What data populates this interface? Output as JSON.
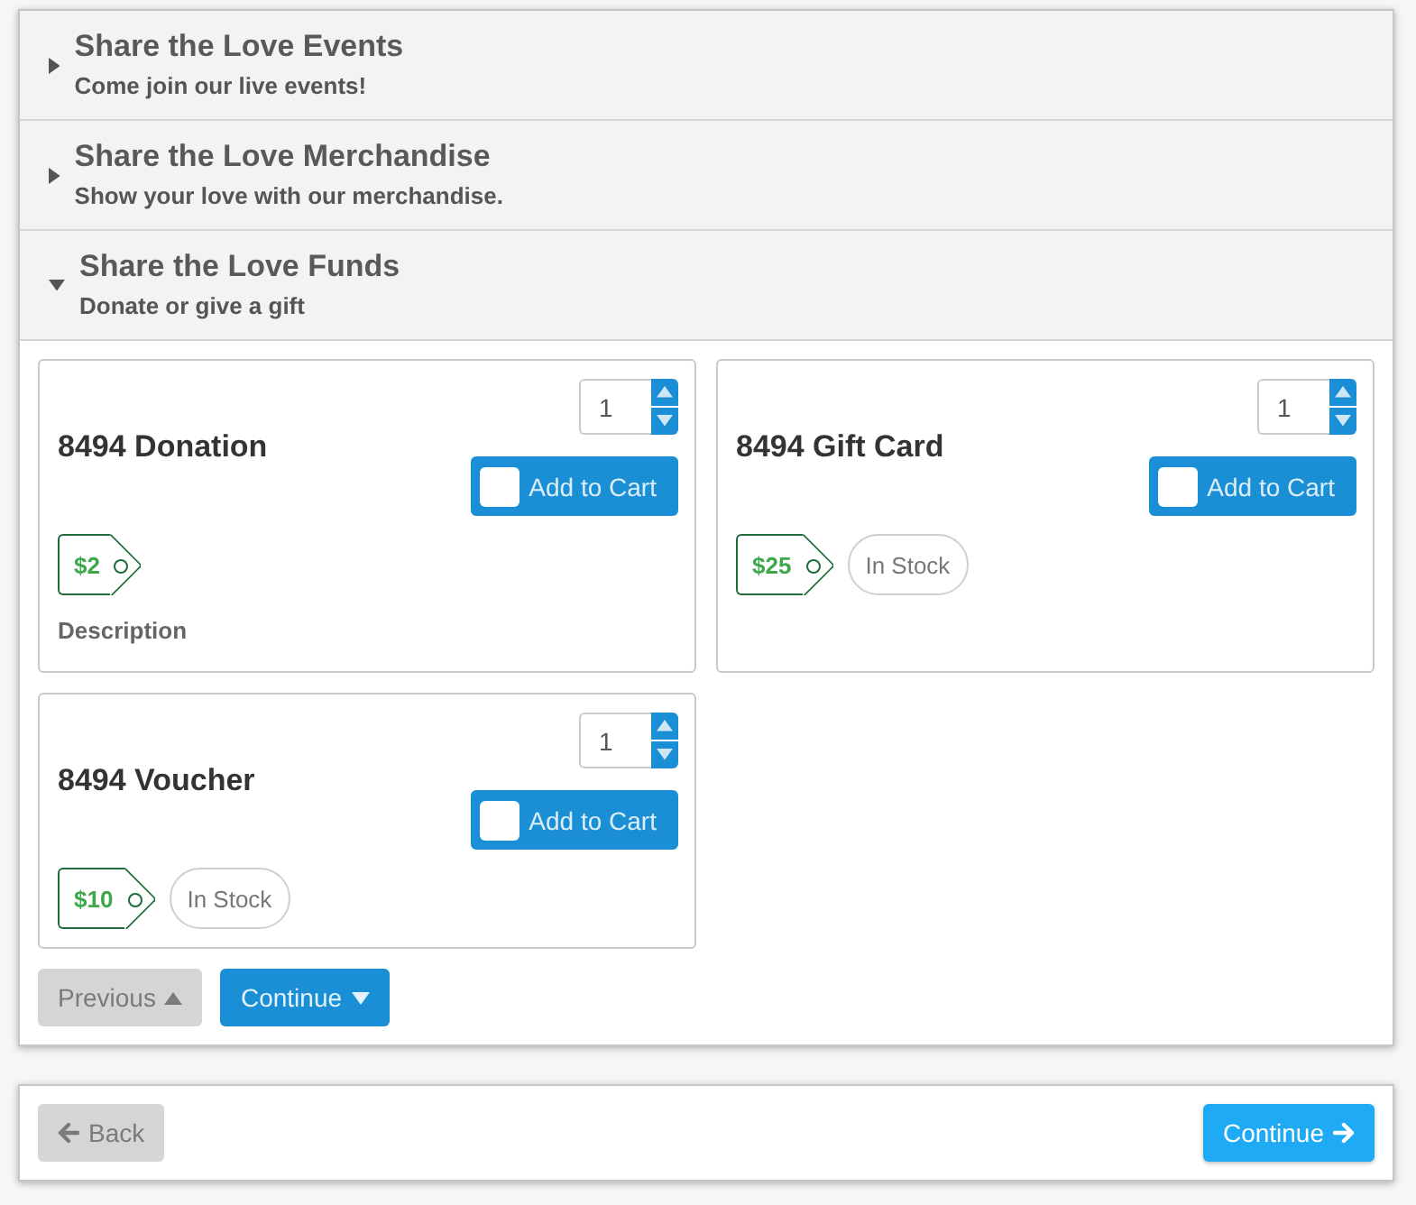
{
  "sections": [
    {
      "title": "Share the Love Events",
      "subtitle": "Come join our live events!",
      "expanded": false
    },
    {
      "title": "Share the Love Merchandise",
      "subtitle": "Show your love with our merchandise.",
      "expanded": false
    },
    {
      "title": "Share the Love Funds",
      "subtitle": "Donate or give a gift",
      "expanded": true,
      "products": [
        {
          "name": "8494 Donation",
          "quantity": "1",
          "checked": false,
          "button": "Add to Cart",
          "price": "$2",
          "description": "Description"
        },
        {
          "name": "8494 Gift Card",
          "quantity": "1",
          "checked": false,
          "button": "Add to Cart",
          "price": "$25",
          "stock": "In Stock"
        },
        {
          "name": "8494 Voucher",
          "quantity": "1",
          "checked": false,
          "button": "Add to Cart",
          "price": "$10",
          "stock": "In Stock"
        }
      ],
      "buttons": [
        {
          "label": "Previous",
          "kind": "previous"
        },
        {
          "label": "Continue",
          "kind": "next"
        }
      ]
    }
  ],
  "footer": {
    "buttons": [
      {
        "label": "Back",
        "kind": "back"
      },
      {
        "label": "Continue",
        "kind": "next"
      }
    ]
  }
}
